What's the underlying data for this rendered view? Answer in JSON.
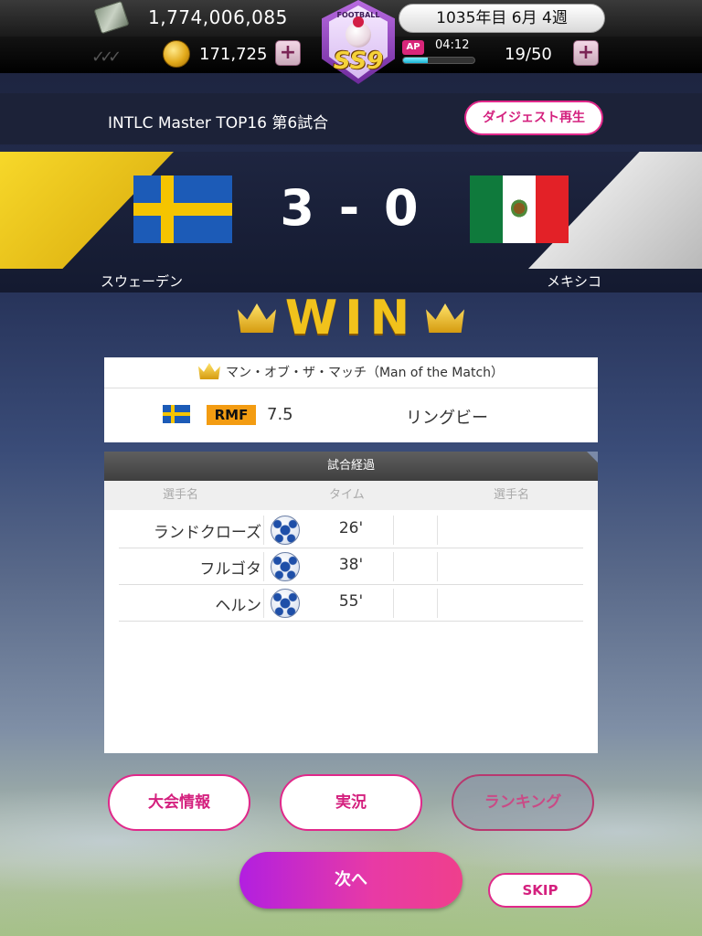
{
  "status": {
    "money": "1,774,006,085",
    "coins": "171,725",
    "date": "1035年目 6月 4週",
    "ap_label": "AP",
    "ap_timer": "04:12",
    "ap_fill_fraction": 0.35,
    "ap_count": "19/50",
    "plus": "+",
    "logo_text": "FOOTBALL",
    "logo_ss": "SS9"
  },
  "match": {
    "title": "INTLC Master TOP16 第6試合",
    "digest_button": "ダイジェスト再生",
    "score": "3 - 0",
    "home_team": "スウェーデン",
    "away_team": "メキシコ",
    "result": "WIN"
  },
  "motm": {
    "header": "マン・オブ・ザ・マッチ（Man of the Match）",
    "position": "RMF",
    "rating": "7.5",
    "player": "リングビー"
  },
  "progress": {
    "title": "試合経過",
    "col_player_home": "選手名",
    "col_time": "タイム",
    "col_player_away": "選手名",
    "goals": [
      {
        "player": "ランドクローズ",
        "time": "26'"
      },
      {
        "player": "フルゴタ",
        "time": "38'"
      },
      {
        "player": "ヘルン",
        "time": "55'"
      }
    ]
  },
  "buttons": {
    "tournament_info": "大会情報",
    "commentary": "実況",
    "ranking": "ランキング",
    "next": "次へ",
    "skip": "SKIP"
  },
  "colors": {
    "accent_pink": "#e0288a",
    "win_gold": "#f1c21c",
    "sweden_blue": "#1c5bb7",
    "sweden_yellow": "#f5c400"
  }
}
